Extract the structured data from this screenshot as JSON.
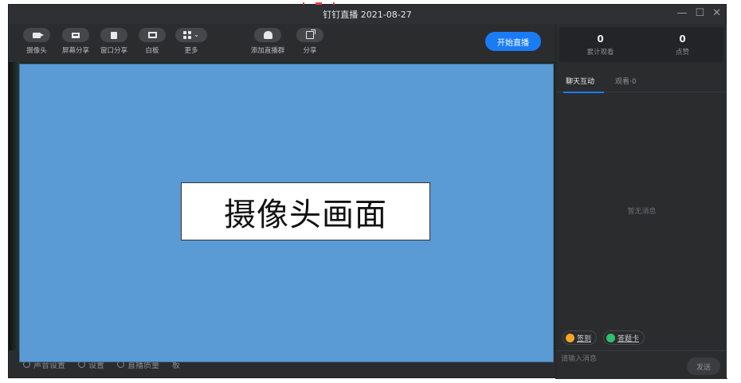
{
  "window": {
    "title": "钉钉直播 2021-08-27",
    "controls": {
      "minimize": "—",
      "maximize": "☐",
      "close": "✕"
    }
  },
  "toolbar": {
    "tools": [
      {
        "label": "摄像头",
        "icon": "camera-icon"
      },
      {
        "label": "屏幕分享",
        "icon": "screen-share-icon"
      },
      {
        "label": "窗口分享",
        "icon": "window-share-icon"
      },
      {
        "label": "白板",
        "icon": "whiteboard-icon"
      },
      {
        "label": "更多",
        "icon": "grid-icon"
      },
      {
        "label": "添加直播群",
        "icon": "add-group-icon"
      },
      {
        "label": "分享",
        "icon": "share-icon"
      }
    ],
    "start_label": "开始直播",
    "start_color": "#1a7cf5"
  },
  "bottombar": {
    "items": [
      "声音设置",
      "设置",
      "直播质量",
      "板"
    ]
  },
  "stats": {
    "views_value": "0",
    "views_label": "累计观看",
    "likes_value": "0",
    "likes_label": "点赞"
  },
  "tabs": {
    "chat": "聊天互动",
    "viewers": "观看·0"
  },
  "chat": {
    "empty": "暂无消息",
    "checkin": "签到",
    "answer_card": "答题卡",
    "input_placeholder": "请输入消息",
    "send_label": "发送"
  },
  "overlay": {
    "label": "摄像头画面",
    "color": "#5b9bd5"
  }
}
